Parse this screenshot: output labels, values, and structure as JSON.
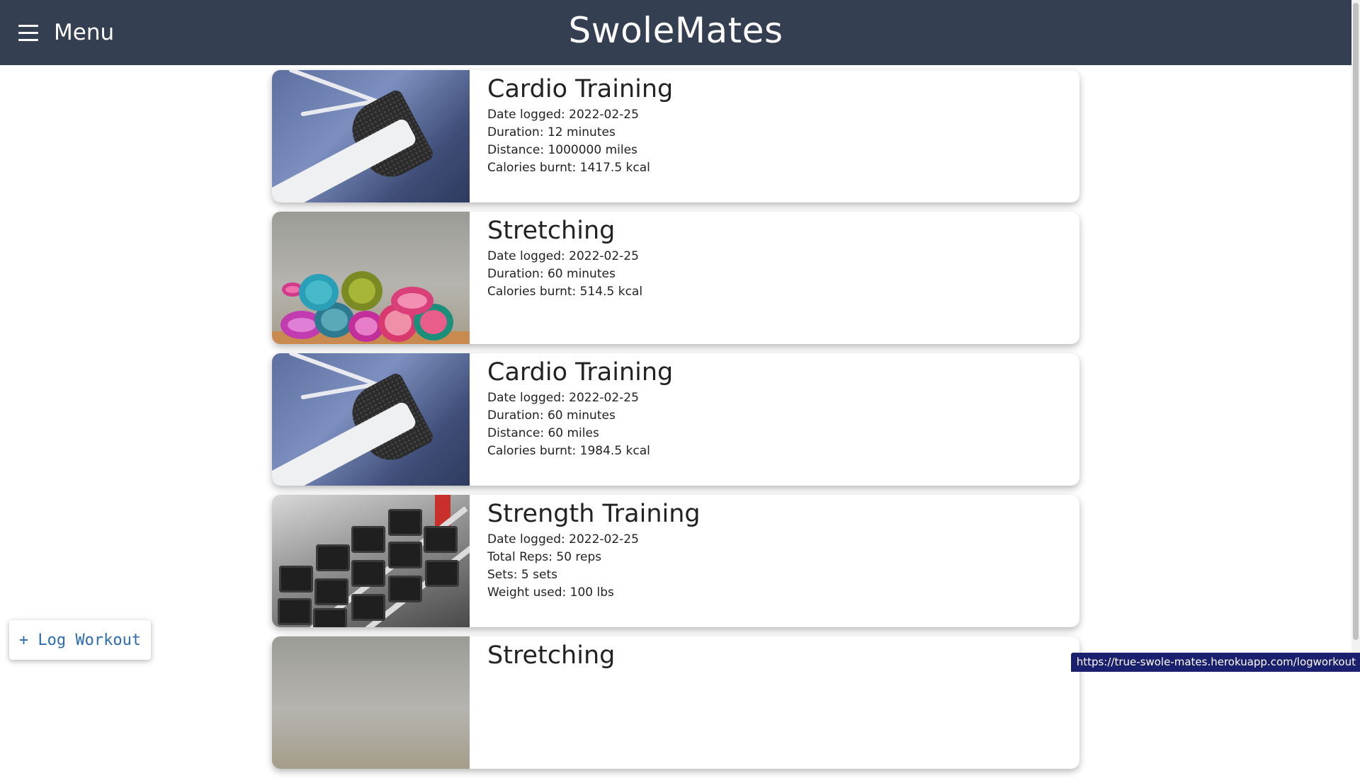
{
  "header": {
    "menu_label": "Menu",
    "brand": "SwoleMates"
  },
  "workouts": [
    {
      "title": "Cardio Training",
      "image": "running-shoe-image",
      "lines": [
        "Date logged: 2022-02-25",
        "Duration: 12 minutes",
        "Distance: 1000000 miles",
        "Calories burnt: 1417.5 kcal"
      ]
    },
    {
      "title": "Stretching",
      "image": "yoga-mats-image",
      "lines": [
        "Date logged: 2022-02-25",
        "Duration: 60 minutes",
        "Calories burnt: 514.5 kcal"
      ]
    },
    {
      "title": "Cardio Training",
      "image": "running-shoe-image",
      "lines": [
        "Date logged: 2022-02-25",
        "Duration: 60 minutes",
        "Distance: 60 miles",
        "Calories burnt: 1984.5 kcal"
      ]
    },
    {
      "title": "Strength Training",
      "image": "dumbbells-image",
      "lines": [
        "Date logged: 2022-02-25",
        "Total Reps: 50 reps",
        "Sets: 5 sets",
        "Weight used: 100 lbs"
      ]
    },
    {
      "title": "Stretching",
      "image": "yoga-mats-image",
      "lines": []
    }
  ],
  "log_button_label": "+ Log Workout",
  "status_url": "https://true-swole-mates.herokuapp.com/logworkout",
  "colors": {
    "header_bg": "#343f52",
    "accent": "#2b6cb0"
  }
}
